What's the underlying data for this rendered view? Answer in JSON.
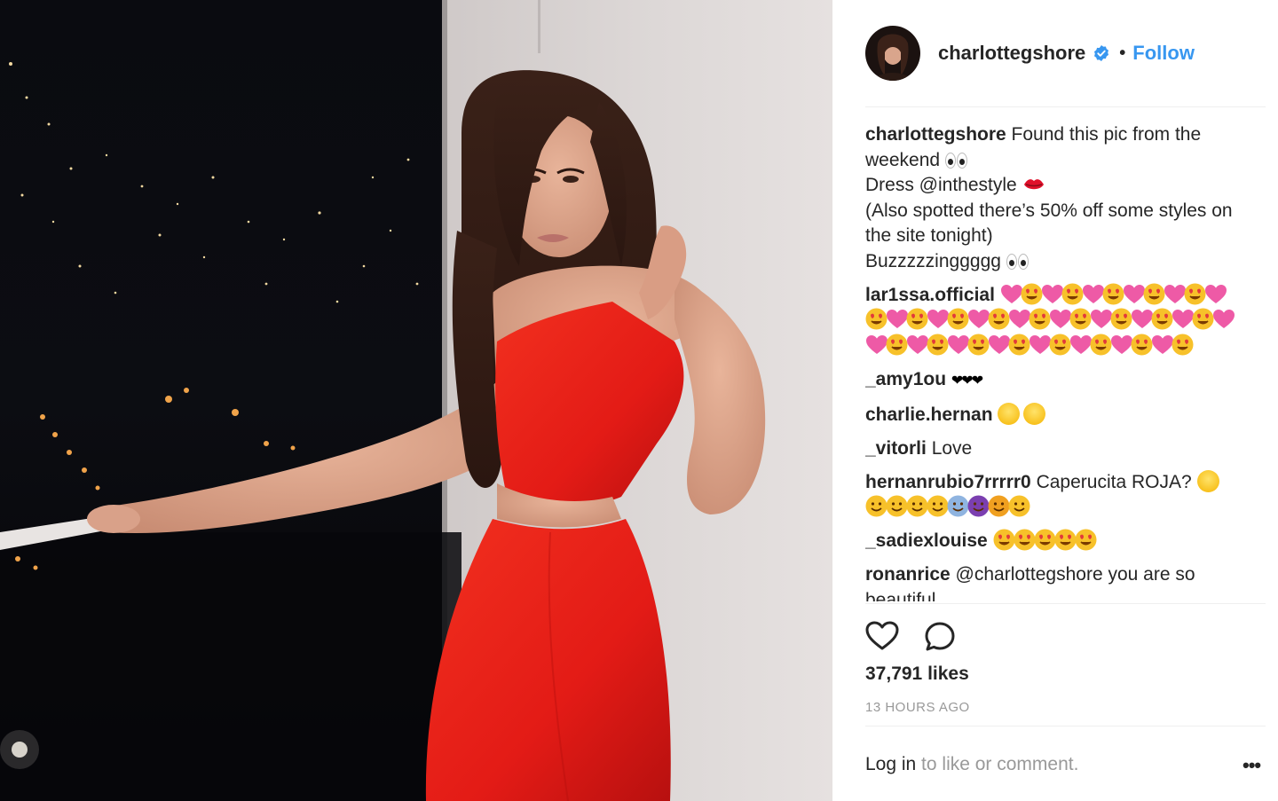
{
  "post": {
    "author": "charlottegshore",
    "follow_label": "Follow",
    "bullet": "•",
    "caption": {
      "user": "charlottegshore",
      "line1": "Found this pic from the weekend",
      "line2": "Dress @inthestyle",
      "line3": "(Also spotted there’s 50% off some styles on the site tonight)",
      "line4": "Buzzzzzinggggg"
    },
    "comments": [
      {
        "user": "lar1ssa.official",
        "text": ""
      },
      {
        "user": "_amy1ou",
        "text": "❤❤❤"
      },
      {
        "user": "charlie.hernan",
        "text": ""
      },
      {
        "user": "_vitorli",
        "text": "Love"
      },
      {
        "user": "hernanrubio7rrrrr0",
        "text": "Caperucita ROJA?"
      },
      {
        "user": "_sadiexlouise",
        "text": ""
      },
      {
        "user": "ronanrice",
        "text": "@charlottegshore you are so beautiful"
      }
    ],
    "likes": "37,791 likes",
    "time_ago": "13 HOURS AGO",
    "login": {
      "link": "Log in",
      "rest": " to like or comment."
    },
    "more": "•••"
  },
  "colors": {
    "accent": "#3897f0",
    "dress": "#e8211c",
    "text": "#262626",
    "muted": "#999999"
  },
  "icons": [
    "verified-badge-icon",
    "heart-icon",
    "comment-icon",
    "more-options-icon"
  ]
}
